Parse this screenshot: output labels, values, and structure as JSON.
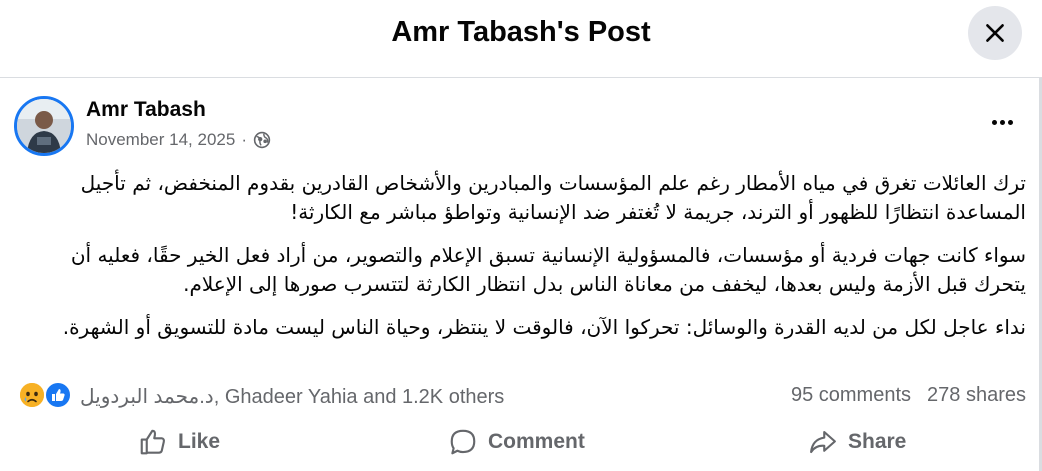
{
  "header": {
    "title": "Amr Tabash's Post"
  },
  "post": {
    "author": "Amr Tabash",
    "date": "November 14, 2025",
    "separator": "·",
    "paragraphs": [
      "ترك العائلات تغرق في مياه الأمطار رغم علم المؤسسات والمبادرين والأشخاص القادرين بقدوم المنخفض، ثم تأجيل المساعدة انتظارًا للظهور أو الترند، جريمة لا تُغتفر ضد الإنسانية وتواطؤ مباشر مع الكارثة!",
      "سواء كانت جهات فردية أو مؤسسات، فالمسؤولية الإنسانية تسبق الإعلام والتصوير، من أراد فعل الخير حقًا، فعليه أن يتحرك قبل الأزمة وليس بعدها، ليخفف من معاناة الناس بدل انتظار الكارثة لتتسرب صورها إلى الإعلام.",
      "نداء عاجل لكل من لديه القدرة والوسائل: تحركوا الآن، فالوقت لا ينتظر، وحياة الناس ليست مادة للتسويق أو الشهرة."
    ]
  },
  "stats": {
    "likers": "د.محمد البردويل, Ghadeer Yahia and 1.2K others",
    "comments": "95 comments",
    "shares": "278 shares"
  },
  "actions": {
    "like": "Like",
    "comment": "Comment",
    "share": "Share"
  },
  "icons": {
    "close": "close-icon",
    "globe": "globe-icon",
    "more": "more-options-icon",
    "like_reaction": "like-reaction-icon",
    "sad_reaction": "sad-reaction-icon",
    "like": "thumbs-up-icon",
    "comment": "comment-icon",
    "share": "share-icon"
  },
  "colors": {
    "accent": "#1877f2",
    "secondary_text": "#65676b",
    "divider": "#dadde1",
    "close_bg": "#e4e6eb"
  }
}
